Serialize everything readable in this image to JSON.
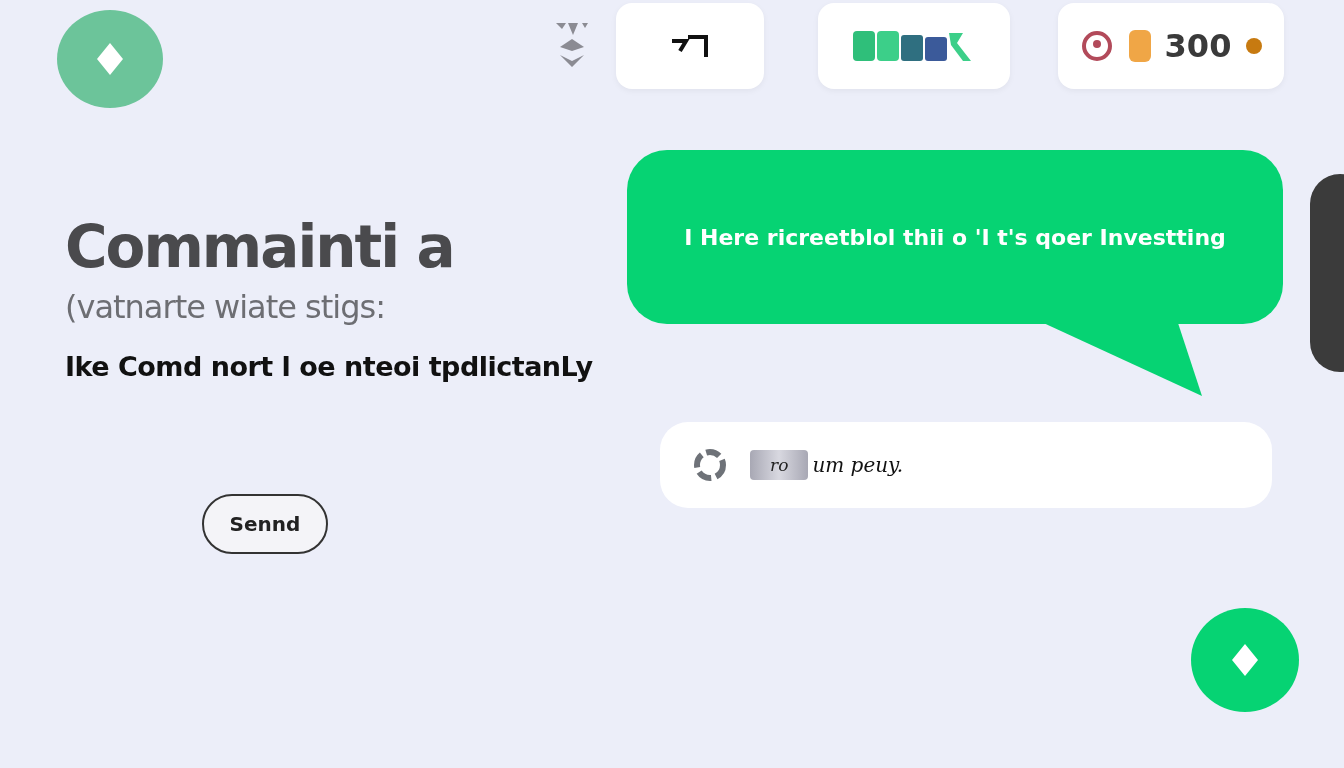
{
  "hero": {
    "title": "Commainti a",
    "subtitle": "(vatnarte wiate stigs:",
    "description": "Ike Comd nort l oe nteoi tpdlictanLy",
    "button": "Sennd"
  },
  "balance": {
    "amount": "300"
  },
  "message": {
    "text": "I Here ricreetblol thii o 'I t's qoer Investting"
  },
  "composer": {
    "chip": "ro",
    "text": "um peuy."
  }
}
